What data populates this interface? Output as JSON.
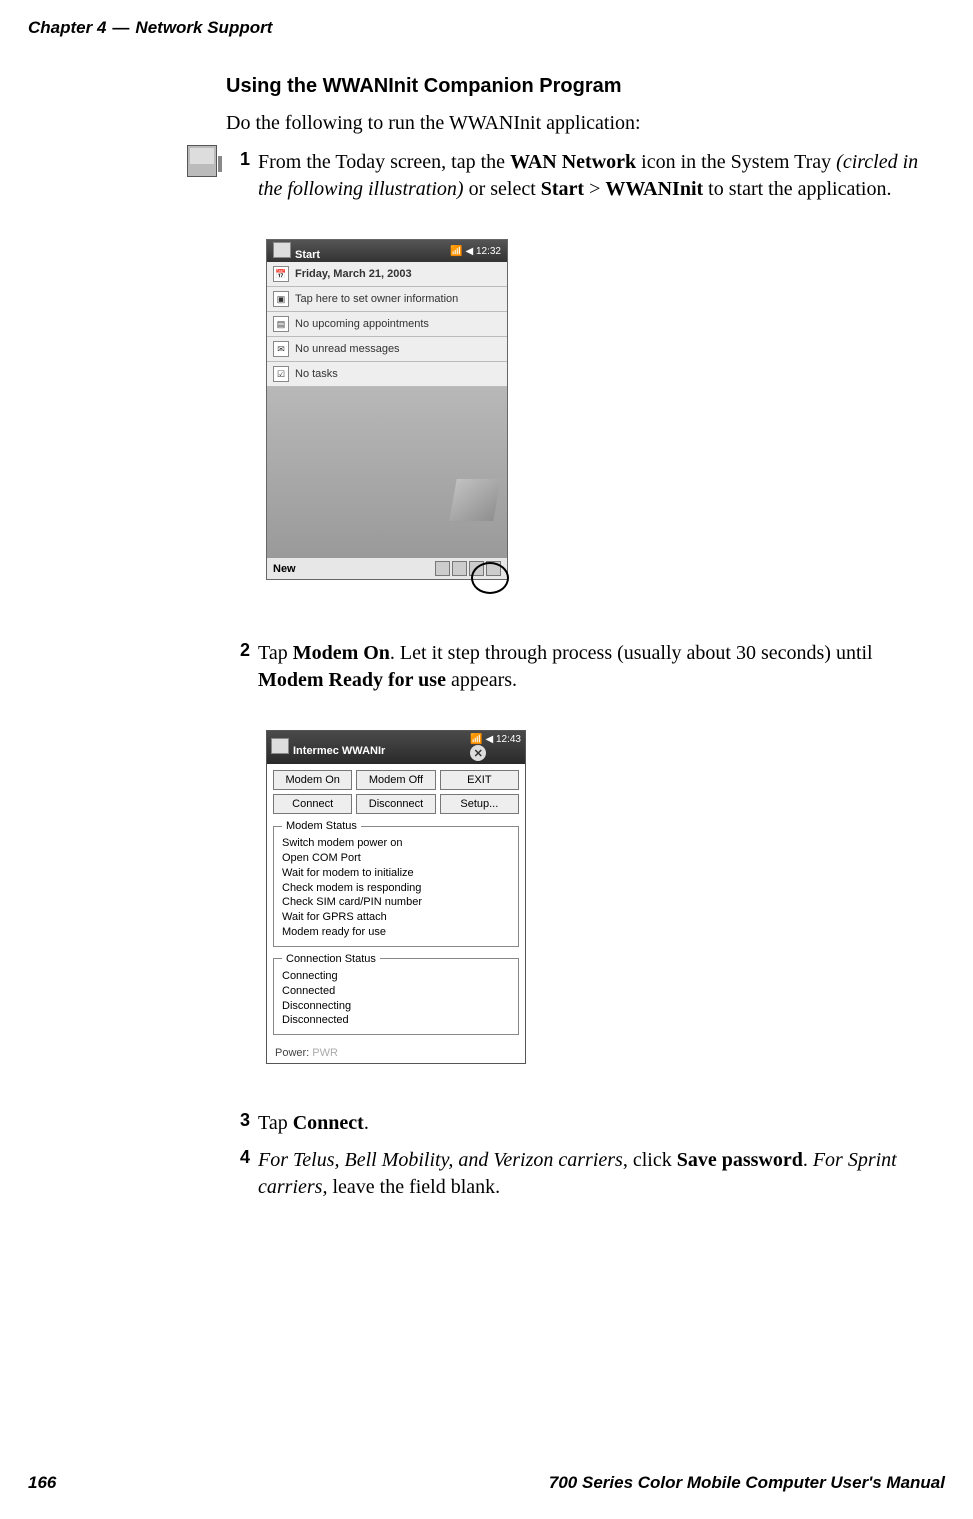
{
  "header": {
    "chapter_label": "Chapter 4",
    "separator": "—",
    "chapter_title": "Network Support"
  },
  "section_title": "Using the WWANInit Companion Program",
  "intro": "Do the following to run the WWANInit application:",
  "step1": {
    "num": "1",
    "part_a": "From the Today screen, tap the ",
    "bold_a": "WAN Network",
    "part_b": " icon in the System Tray ",
    "italic_a": "(circled in the following illustration)",
    "part_c": " or select ",
    "bold_b": "Start",
    "gt": " > ",
    "bold_c": "WWANInit",
    "part_d": " to start the application."
  },
  "today_screen": {
    "title_left": "Start",
    "title_right": "12:32",
    "date": "Friday, March 21, 2003",
    "owner": "Tap here to set owner information",
    "appts": "No upcoming appointments",
    "msgs": "No unread messages",
    "tasks": "No tasks",
    "new_label": "New"
  },
  "step2": {
    "num": "2",
    "part_a": "Tap ",
    "bold_a": "Modem On",
    "part_b": ". Let it step through process (usually about 30 seconds) until ",
    "bold_b": "Modem Ready for use",
    "part_c": " appears."
  },
  "wwan": {
    "title": "Intermec WWANIr",
    "time": "12:43",
    "buttons": {
      "modem_on": "Modem On",
      "modem_off": "Modem Off",
      "exit": "EXIT",
      "connect": "Connect",
      "disconnect": "Disconnect",
      "setup": "Setup..."
    },
    "modem_status_legend": "Modem Status",
    "modem_status": [
      "Switch modem power on",
      "Open COM Port",
      "Wait for modem to initialize",
      "Check modem is responding",
      "Check SIM card/PIN number",
      "Wait for GPRS attach",
      "Modem ready for use"
    ],
    "conn_status_legend": "Connection Status",
    "conn_status": [
      "Connecting",
      "Connected",
      "Disconnecting",
      "Disconnected"
    ],
    "power_label": "Power: ",
    "power_value": "PWR"
  },
  "step3": {
    "num": "3",
    "part_a": "Tap ",
    "bold_a": "Connect",
    "part_b": "."
  },
  "step4": {
    "num": "4",
    "italic_a": "For Telus, Bell Mobility, and Verizon carriers",
    "part_a": ", click ",
    "bold_a": "Save password",
    "part_b": ". ",
    "italic_b": "For Sprint carriers,",
    "part_c": " leave the field blank."
  },
  "footer": {
    "page_num": "166",
    "manual_title": "700 Series Color Mobile Computer User's Manual"
  }
}
